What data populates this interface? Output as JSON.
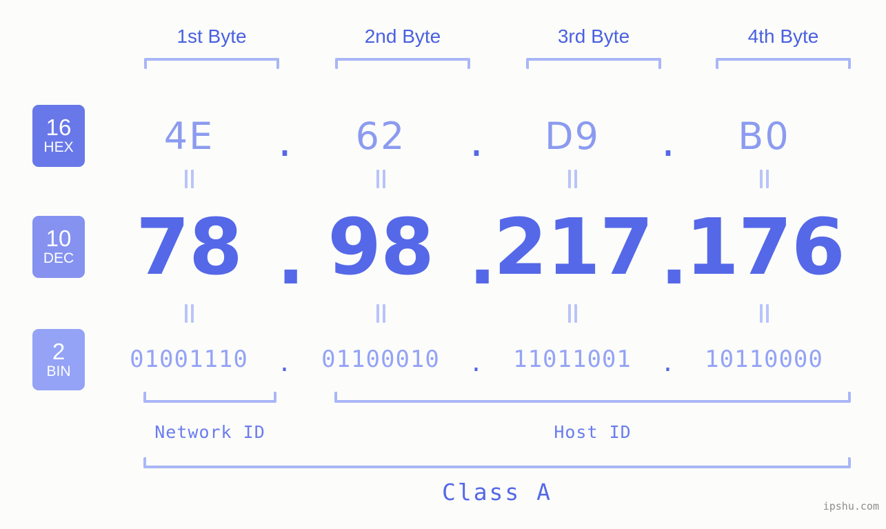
{
  "background_color": "#fcfdfa",
  "accent_colors": {
    "strong_blue": "#5568e8",
    "mid_blue": "#8c9bf0",
    "light_blue": "#94a3f6",
    "bracket_blue": "#a9b6f7",
    "badge_hex": "#6878e8",
    "badge_dec": "#8592ef",
    "badge_bin": "#94a3f6",
    "watermark_gray": "#8d8d8d"
  },
  "byte_headers": [
    {
      "label": "1st Byte"
    },
    {
      "label": "2nd Byte"
    },
    {
      "label": "3rd Byte"
    },
    {
      "label": "4th Byte"
    }
  ],
  "bases": [
    {
      "number": "16",
      "name": "HEX"
    },
    {
      "number": "10",
      "name": "DEC"
    },
    {
      "number": "2",
      "name": "BIN"
    }
  ],
  "separator": ".",
  "rows": {
    "hex": {
      "base_number": "16",
      "base_name": "HEX",
      "values": [
        "4E",
        "62",
        "D9",
        "B0"
      ]
    },
    "dec": {
      "base_number": "10",
      "base_name": "DEC",
      "values": [
        "78",
        "98",
        "217",
        "176"
      ]
    },
    "bin": {
      "base_number": "2",
      "base_name": "BIN",
      "values": [
        "01001110",
        "01100010",
        "11011001",
        "10110000"
      ]
    }
  },
  "equality_symbol": "=",
  "segments": {
    "network_id": "Network ID",
    "host_id": "Host ID"
  },
  "class_label": "Class A",
  "watermark": "ipshu.com"
}
